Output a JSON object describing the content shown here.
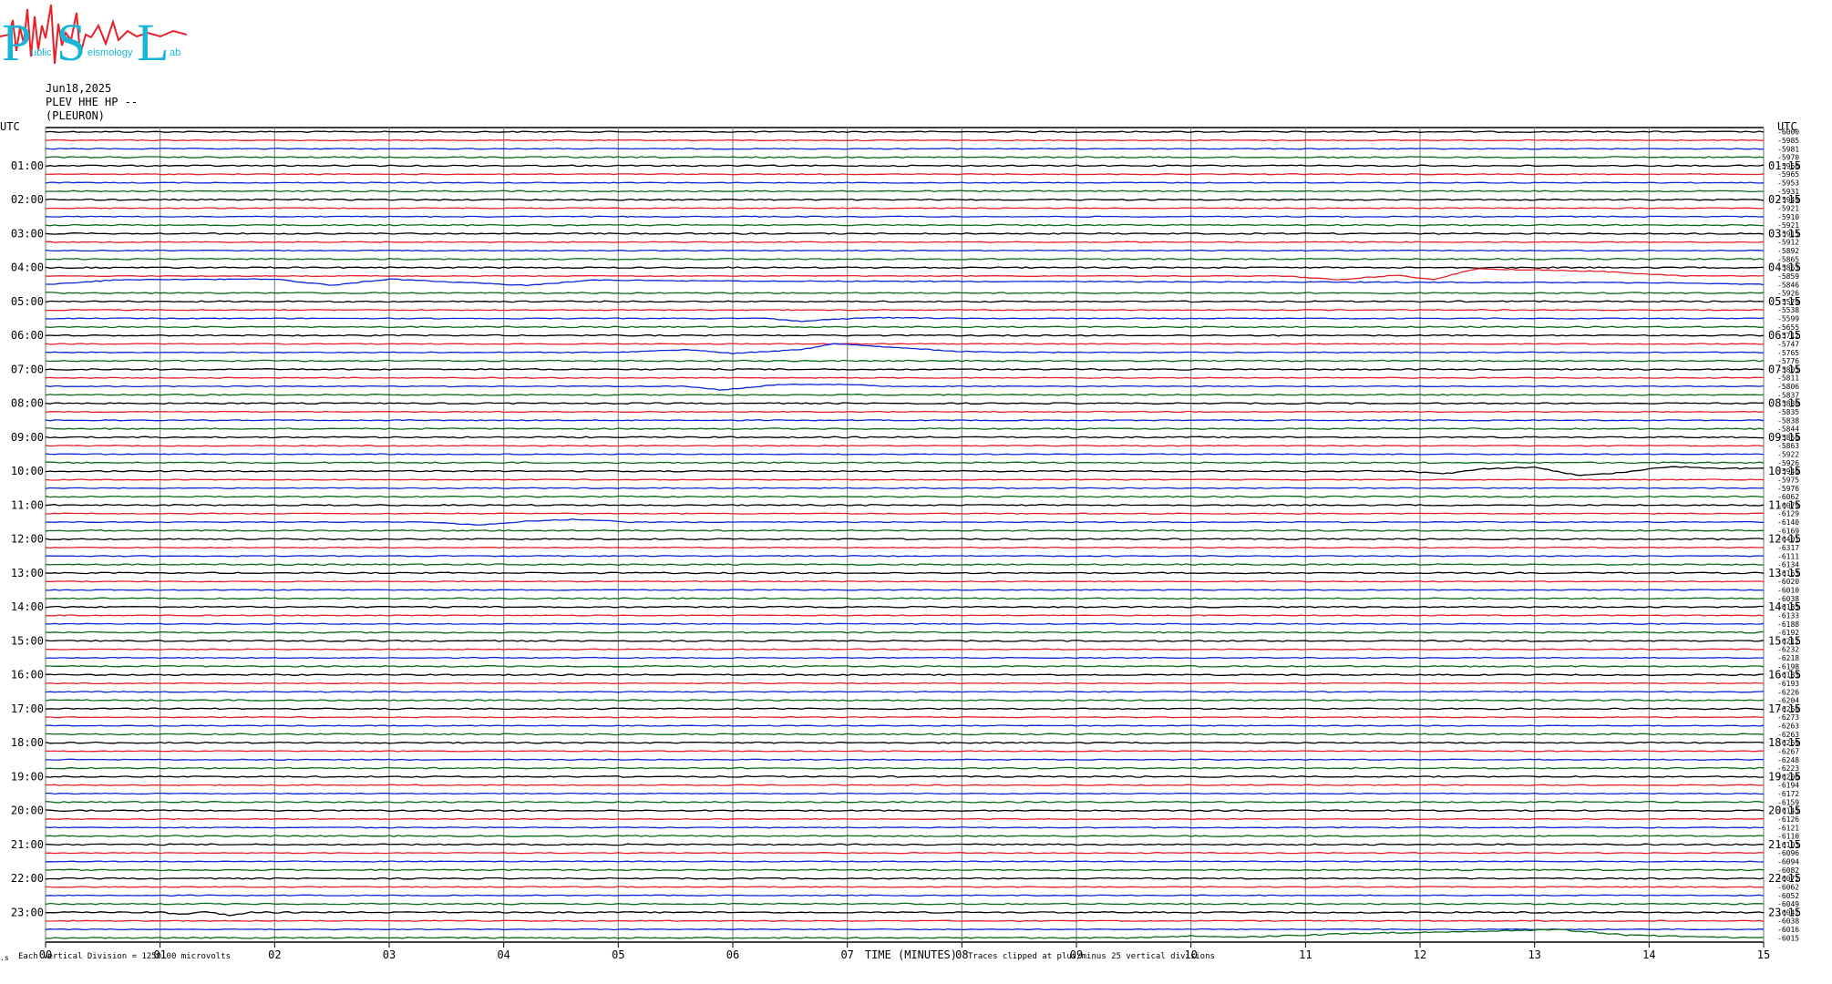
{
  "logo": {
    "letters": [
      "P",
      "S",
      "L"
    ],
    "small_words": [
      "ublic",
      "eismology",
      "ab"
    ],
    "colors": {
      "letters": "#19b5d6",
      "wave": "#e8202a"
    }
  },
  "header": {
    "date": "Jun18,2025",
    "station": "PLEV HHE HP --",
    "location": "(PLEURON)"
  },
  "chart_data": {
    "type": "line",
    "title": "",
    "left_axis_label": "UTC",
    "right_axis_label": "UTC",
    "xlabel": "TIME (MINUTES)",
    "x_range": [
      0,
      15
    ],
    "x_ticks": [
      "00",
      "01",
      "02",
      "03",
      "04",
      "05",
      "06",
      "07",
      "08",
      "09",
      "10",
      "11",
      "12",
      "13",
      "14",
      "15"
    ],
    "rows_per_hour": 4,
    "row_count": 96,
    "left_hour_labels": [
      "01:00",
      "02:00",
      "03:00",
      "04:00",
      "05:00",
      "06:00",
      "07:00",
      "08:00",
      "09:00",
      "10:00",
      "11:00",
      "12:00",
      "13:00",
      "14:00",
      "15:00",
      "16:00",
      "17:00",
      "18:00",
      "19:00",
      "20:00",
      "21:00",
      "22:00",
      "23:00"
    ],
    "right_hour_labels": [
      "01:15",
      "02:15",
      "03:15",
      "04:15",
      "05:15",
      "06:15",
      "07:15",
      "08:15",
      "09:15",
      "10:15",
      "11:15",
      "12:15",
      "13:15",
      "14:15",
      "15:15",
      "16:15",
      "17:15",
      "18:15",
      "19:15",
      "20:15",
      "21:15",
      "22:15",
      "23:15"
    ],
    "trace_colors": [
      "#000000",
      "#e8202a",
      "#0b28d8",
      "#0a6b1a"
    ],
    "grid": true,
    "offsets": [
      "-6000",
      "-5985",
      "-5981",
      "-5970",
      "-5966",
      "-5965",
      "-5953",
      "-5931",
      "-5949",
      "-5921",
      "-5910",
      "-5921",
      "-5915",
      "-5912",
      "-5892",
      "-5865",
      "-5863",
      "-5859",
      "-5846",
      "-5926",
      "-5579",
      "-5538",
      "-5599",
      "-5655",
      "-5712",
      "-5747",
      "-5765",
      "-5776",
      "-5805",
      "-5811",
      "-5806",
      "-5837",
      "-5830",
      "-5835",
      "-5838",
      "-5844",
      "-5850",
      "-5863",
      "-5922",
      "-5926",
      "-5940",
      "-5975",
      "-5976",
      "-6062",
      "-6079",
      "-6129",
      "-6140",
      "-6169",
      "-6401",
      "-6317",
      "-6111",
      "-6134",
      "-6163",
      "-6020",
      "-6010",
      "-6038",
      "-6185",
      "-6133",
      "-6188",
      "-6192",
      "-6212",
      "-6232",
      "-6218",
      "-6198",
      "-6183",
      "-6193",
      "-6226",
      "-6204",
      "-6260",
      "-6273",
      "-6263",
      "-6263",
      "-6269",
      "-6267",
      "-6248",
      "-6223",
      "-6206",
      "-6194",
      "-6172",
      "-6159",
      "-6145",
      "-6126",
      "-6121",
      "-6110",
      "-6103",
      "-6096",
      "-6094",
      "-6082",
      "-6072",
      "-6062",
      "-6052",
      "-6049",
      "-6042",
      "-6038",
      "-6016",
      "-6015"
    ],
    "events": [
      {
        "row": 18,
        "shape": [
          [
            0,
            0
          ],
          [
            0.6,
            -5
          ],
          [
            2.0,
            -6
          ],
          [
            2.2,
            -3
          ],
          [
            2.5,
            1
          ],
          [
            3.0,
            -6
          ],
          [
            4.2,
            1
          ],
          [
            4.8,
            -5
          ],
          [
            5.5,
            -4
          ],
          [
            14.1,
            -2
          ],
          [
            15,
            0
          ]
        ]
      },
      {
        "row": 17,
        "shape": [
          [
            10.8,
            0
          ],
          [
            11.3,
            4
          ],
          [
            11.8,
            -1
          ],
          [
            12.1,
            4
          ],
          [
            12.5,
            -8
          ],
          [
            13.6,
            -5
          ],
          [
            14.3,
            0
          ]
        ]
      },
      {
        "row": 22,
        "shape": [
          [
            6.3,
            0
          ],
          [
            6.6,
            3
          ],
          [
            7.2,
            -1
          ],
          [
            8.0,
            0
          ]
        ]
      },
      {
        "row": 26,
        "shape": [
          [
            5.0,
            0
          ],
          [
            5.6,
            -3
          ],
          [
            6.0,
            1
          ],
          [
            6.6,
            -3
          ],
          [
            6.9,
            -10
          ],
          [
            7.3,
            -6
          ],
          [
            8.0,
            -1
          ],
          [
            8.5,
            0
          ]
        ]
      },
      {
        "row": 30,
        "shape": [
          [
            5.6,
            0
          ],
          [
            5.9,
            4
          ],
          [
            6.4,
            -2
          ],
          [
            7.0,
            -2
          ],
          [
            7.3,
            0
          ]
        ]
      },
      {
        "row": 40,
        "shape": [
          [
            11.9,
            0
          ],
          [
            12.2,
            3
          ],
          [
            12.6,
            -3
          ],
          [
            13.0,
            -4
          ],
          [
            13.4,
            5
          ],
          [
            13.8,
            1
          ],
          [
            14.2,
            -5
          ],
          [
            14.7,
            -3
          ],
          [
            15,
            -3
          ]
        ]
      },
      {
        "row": 46,
        "shape": [
          [
            3.3,
            0
          ],
          [
            3.8,
            3
          ],
          [
            4.2,
            -1
          ],
          [
            4.6,
            -3
          ],
          [
            5.0,
            -1
          ]
        ]
      },
      {
        "row": 92,
        "shape": [
          [
            1.0,
            0
          ],
          [
            1.2,
            2
          ],
          [
            1.4,
            -1
          ],
          [
            1.6,
            3
          ],
          [
            1.8,
            0
          ]
        ]
      },
      {
        "row": 95,
        "shape": [
          [
            9.5,
            0
          ],
          [
            10.0,
            -2
          ],
          [
            10.5,
            -1
          ],
          [
            11.5,
            -5
          ],
          [
            12.5,
            -7
          ],
          [
            13.2,
            -9
          ],
          [
            13.8,
            -3
          ],
          [
            14.5,
            -1
          ],
          [
            15,
            0
          ]
        ]
      }
    ],
    "scale_note": "Each Vertical Division = 1250.00 microvolts",
    "clip_note": "Traces clipped at plus/minus 25 vertical divisions",
    "corner_mark": ".s"
  }
}
